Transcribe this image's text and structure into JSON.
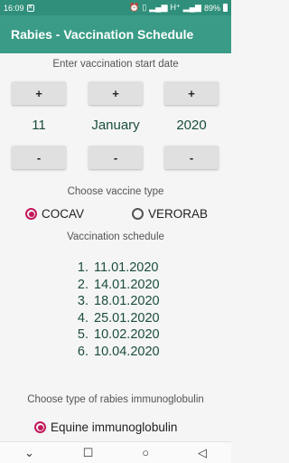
{
  "status": {
    "time": "16:09",
    "right_text": "H⁺",
    "battery": "89%"
  },
  "app": {
    "title": "Rabies - Vaccination Schedule"
  },
  "start_date": {
    "label": "Enter vaccination start date",
    "plus": "+",
    "minus": "-",
    "day": "11",
    "month": "January",
    "year": "2020"
  },
  "vaccine": {
    "label": "Choose vaccine type",
    "options": [
      {
        "label": "COCAV",
        "selected": true
      },
      {
        "label": "VERORAB",
        "selected": false
      }
    ]
  },
  "schedule": {
    "label": "Vaccination schedule",
    "items": [
      {
        "n": "1.",
        "date": "11.01.2020"
      },
      {
        "n": "2.",
        "date": "14.01.2020"
      },
      {
        "n": "3.",
        "date": "18.01.2020"
      },
      {
        "n": "4.",
        "date": "25.01.2020"
      },
      {
        "n": "5.",
        "date": "10.02.2020"
      },
      {
        "n": "6.",
        "date": "10.04.2020"
      }
    ]
  },
  "immunoglobulin": {
    "label": "Choose type of rabies immunoglobulin",
    "option": "Equine immunoglobulin",
    "selected": true
  },
  "colors": {
    "app_bar": "#3a9c86",
    "status_bar": "#2f8f7a",
    "accent": "#c2185b",
    "value_text": "#1b4d3e"
  }
}
